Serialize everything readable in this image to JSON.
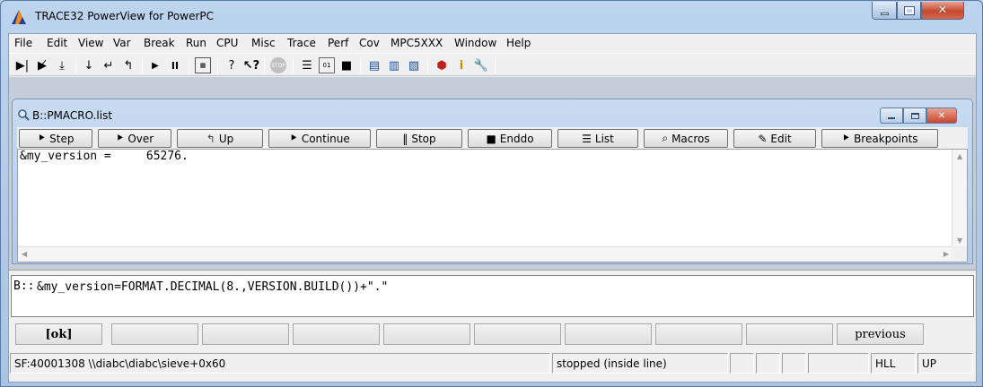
{
  "window": {
    "title": "TRACE32 PowerView for PowerPC"
  },
  "menu": [
    "File",
    "Edit",
    "View",
    "Var",
    "Break",
    "Run",
    "CPU",
    "Misc",
    "Trace",
    "Perf",
    "Cov",
    "MPC5XXX",
    "Window",
    "Help"
  ],
  "toolbar": {
    "icons": [
      "step-icon",
      "step-over-icon",
      "step-up-icon",
      "step-into-icon",
      "return-icon",
      "up-icon",
      "go-icon",
      "break-icon",
      "memory-icon",
      "help-icon",
      "context-help-icon",
      "stop-icon",
      "list-icon",
      "register-icon",
      "chip-icon",
      "trace-list-icon",
      "trace-chart-icon",
      "trace-config-icon",
      "debug-icon",
      "info-icon",
      "settings-icon"
    ]
  },
  "child_window": {
    "title": "B::PMACRO.list",
    "buttons": [
      {
        "label": "Step",
        "icon": "step-icon"
      },
      {
        "label": "Over",
        "icon": "step-over-icon"
      },
      {
        "label": "Up",
        "icon": "up-icon"
      },
      {
        "label": "Continue",
        "icon": "continue-icon"
      },
      {
        "label": "Stop",
        "icon": "stop-icon"
      },
      {
        "label": "Enddo",
        "icon": "enddo-icon"
      },
      {
        "label": "List",
        "icon": "list-icon"
      },
      {
        "label": "Macros",
        "icon": "macros-icon"
      },
      {
        "label": "Edit",
        "icon": "edit-icon"
      },
      {
        "label": "Breakpoints",
        "icon": "breakpoints-icon"
      }
    ],
    "content": "&my_version =     65276."
  },
  "command": {
    "prompt": "B::",
    "value": "&my_version=FORMAT.DECIMAL(8.,VERSION.BUILD())+\".\""
  },
  "softkeys": {
    "ok": "[ok]",
    "previous": "previous"
  },
  "status": {
    "address": "SF:40001308  \\\\diabc\\diabc\\sieve+0x60",
    "state": "stopped (inside line)",
    "mode": "HLL",
    "direction": "UP"
  }
}
